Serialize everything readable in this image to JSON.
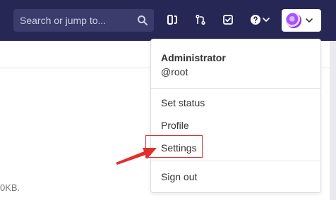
{
  "header": {
    "search_placeholder": "Search or jump to..."
  },
  "icons": {
    "search": "search-icon",
    "merge_requests": "merge-request-icon",
    "issues": "issues-icon",
    "todos": "todo-icon",
    "help": "question-icon",
    "chevron": "chevron-down-icon"
  },
  "user_menu": {
    "name": "Administrator",
    "username": "@root",
    "items": {
      "set_status": "Set status",
      "profile": "Profile",
      "settings": "Settings",
      "sign_out": "Sign out"
    }
  },
  "background": {
    "footer_fragment": "0KB."
  },
  "colors": {
    "header_bg": "#272756",
    "annotation": "#d62f2f"
  }
}
